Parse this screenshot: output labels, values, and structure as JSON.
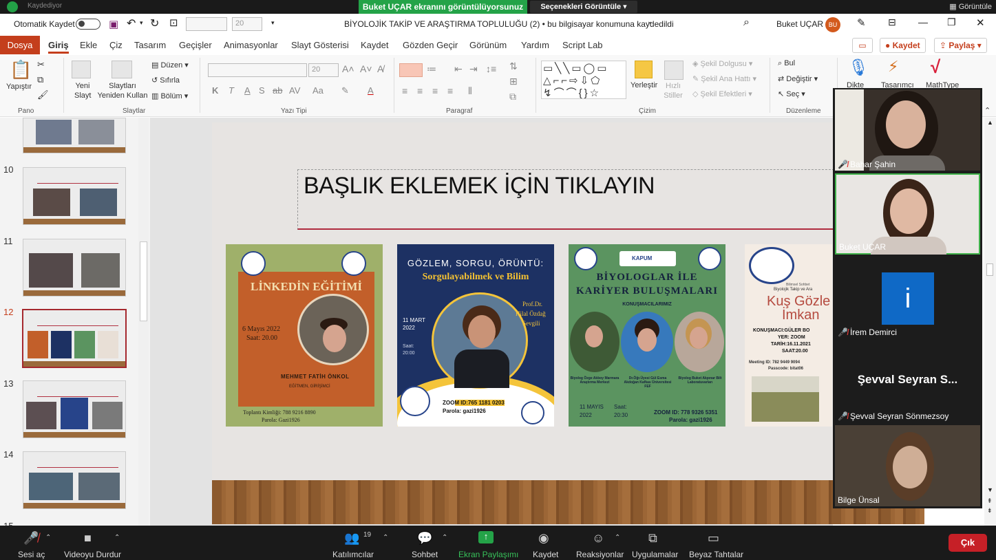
{
  "zoom_banner": {
    "recording": "Kaydediyor",
    "sharing_text": "Buket UÇAR ekranını görüntülüyorsunuz",
    "options_label": "Seçenekleri Görüntüle",
    "view_label": "Görüntüle"
  },
  "titlebar": {
    "autosave": "Otomatik Kaydet",
    "font_size_box": "20",
    "document_title": "BİYOLOJİK TAKİP VE ARAŞTIRMA TOPLULUĞU (2) • bu bilgisayar konumuna kaydedildi",
    "user_name": "Buket UÇAR",
    "user_initials": "BU"
  },
  "menu": {
    "file": "Dosya",
    "items": [
      "Giriş",
      "Ekle",
      "Çiz",
      "Tasarım",
      "Geçişler",
      "Animasyonlar",
      "Slayt Gösterisi",
      "Kaydet",
      "Gözden Geçir",
      "Görünüm",
      "Yardım",
      "Script Lab"
    ],
    "save_button": "Kaydet",
    "share_button": "Paylaş"
  },
  "ribbon": {
    "paste": "Yapıştır",
    "new_slide": "Yeni Slayt",
    "reuse_slides": "Slaytları Yeniden Kullan",
    "layout": "Düzen",
    "reset": "Sıfırla",
    "section": "Bölüm",
    "font_size": "20",
    "arrange": "Yerleştir",
    "quick_styles": "Hızlı Stiller",
    "shape_fill": "Şekil Dolgusu",
    "shape_outline": "Şekil Ana Hattı",
    "shape_effects": "Şekil Efektleri",
    "find": "Bul",
    "replace": "Değiştir",
    "select": "Seç",
    "dictate": "Dikte",
    "designer": "Tasarımcı",
    "mathtype": "MathType",
    "groups": {
      "clipboard": "Pano",
      "slides": "Slaytlar",
      "font": "Yazı Tipi",
      "paragraph": "Paragraf",
      "drawing": "Çizim",
      "editing": "Düzenleme"
    }
  },
  "thumbnails": [
    "10",
    "11",
    "12",
    "13",
    "14",
    "15"
  ],
  "slide": {
    "title": "BAŞLIK EKLEMEK İÇİN TIKLAYIN",
    "posters": [
      {
        "title": "LİNKEDİN EĞİTİMİ",
        "date": "6 Mayıs 2022",
        "time": "Saat: 20.00",
        "speaker": "MEHMET FATİH ÖNKOL",
        "role": "EĞİTMEN, GİRİŞİMCİ",
        "meeting": "Toplantı Kimliği: 788 9216 8890",
        "pass": "Parola: Gazi1926"
      },
      {
        "title1": "GÖZLEM, SORGU, ÖRÜNTÜ:",
        "title2": "Sorgulayabilmek ve Bilim",
        "speaker_title": "Prof.Dr.",
        "speaker1": "Hilal Özdağ",
        "speaker2": "Sevgili",
        "date1": "11 MART",
        "date2": "2022",
        "time1": "Saat:",
        "time2": "20:00",
        "zoom": "ZOOM ID:765 1181 0203",
        "pass": "Parola: gazi1926"
      },
      {
        "org": "KAPUM",
        "title1": "BİYOLOGLAR İLE",
        "title2": "KARİYER BULUŞMALARI",
        "subtitle": "KONUŞMACILARIMIZ",
        "s1": "Biyolog Özge Akboy Marmara Araştırma Merkezi",
        "s2": "Dr.Öğr.Üyesi Gül Esma Akdoğan Kafkas Üniversitesi FEF",
        "s3": "Biyolog Buket Akpınar Bilt Laboratuvarları",
        "date1": "11 MAYIS",
        "date2": "2022",
        "time1": "Saat:",
        "time2": "20:30",
        "zoom": "ZOOM ID: 778 9326 5351",
        "pass": "Parola: gazi1926"
      },
      {
        "small": "Bilimsel Sohbet",
        "org": "Biyolojik Takip ve Ara",
        "title1": "Kuş Gözle",
        "title2": "İmkan",
        "speaker": "KONUŞMACI:GÜLER BO",
        "place": "YER: ZOOM",
        "date": "TARİH:16.11.2021",
        "time": "SAAT:20.00",
        "meeting": "Meeting ID: 782 9449 9094",
        "passcode": "Passcode: bitat06"
      }
    ]
  },
  "participants": [
    {
      "name": "Bahar Şahin",
      "muted": true
    },
    {
      "name": "Buket UÇAR",
      "muted": false
    },
    {
      "name": "İrem Demirci",
      "muted": true,
      "initial": "i"
    },
    {
      "name": "Şevval Seyran Sönmezsoy",
      "muted": true,
      "label": "Şevval Seyran S..."
    },
    {
      "name": "Bilge Ünsal",
      "muted": false
    }
  ],
  "zoom_controls": {
    "unmute": "Sesi aç",
    "stop_video": "Videoyu Durdur",
    "participants": "Katılımcılar",
    "participant_count": "19",
    "chat": "Sohbet",
    "share_screen": "Ekran Paylaşımı",
    "record": "Kaydet",
    "reactions": "Reaksiyonlar",
    "apps": "Uygulamalar",
    "whiteboards": "Beyaz Tahtalar",
    "leave": "Çık"
  },
  "colors": {
    "accent": "#c43e1c",
    "zoom_green": "#24a348",
    "zoom_red": "#c62027"
  }
}
